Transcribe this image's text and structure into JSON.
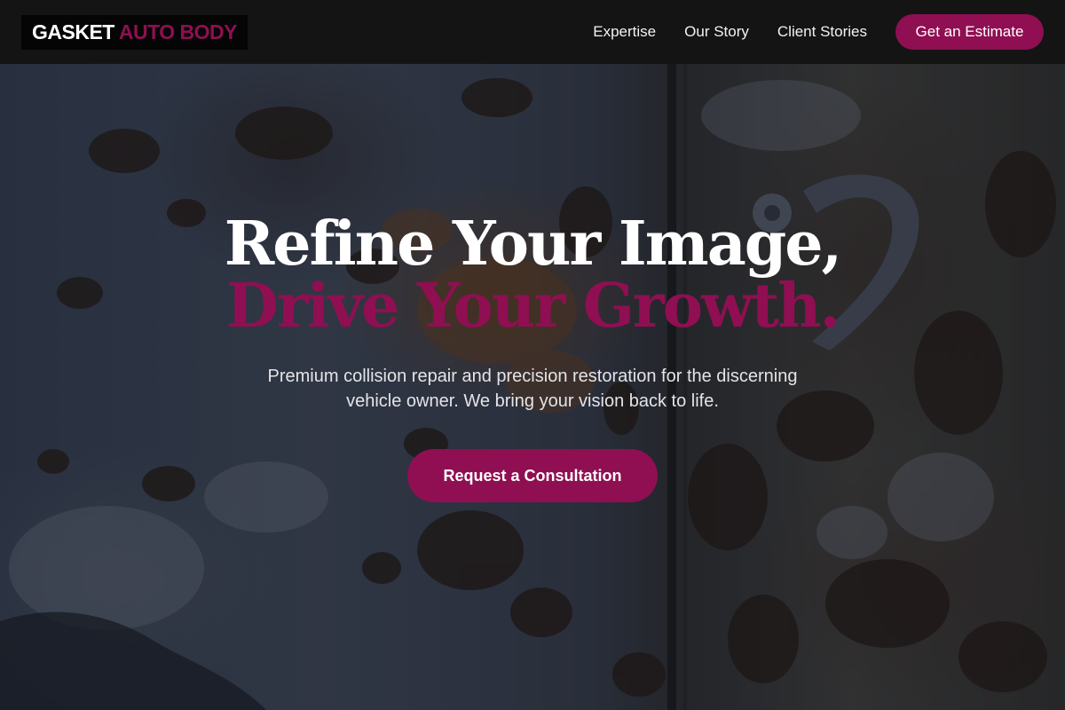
{
  "brand": {
    "name_primary": "GASKET",
    "name_accent": "AUTO BODY"
  },
  "nav": {
    "links": [
      "Expertise",
      "Our Story",
      "Client Stories"
    ],
    "cta_label": "Get an Estimate"
  },
  "hero": {
    "headline_line1": "Refine Your Image,",
    "headline_line2": "Drive Your Growth.",
    "subtext": "Premium collision repair and precision restoration for the discerning vehicle owner. We bring your vision back to life.",
    "cta_label": "Request a Consultation"
  },
  "colors": {
    "accent": "#8f0f52",
    "header_bg": "#141414",
    "text": "#ffffff"
  }
}
